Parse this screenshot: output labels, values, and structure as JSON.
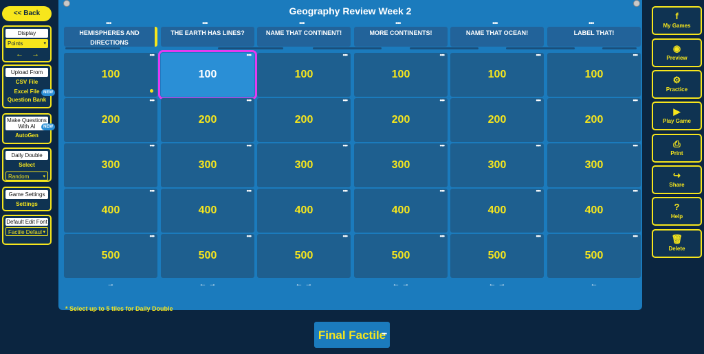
{
  "nav": {
    "back_label": "<< Back"
  },
  "left_panel": {
    "display": {
      "title": "Display",
      "selected": "Points",
      "prev_arrow": "←",
      "next_arrow": "→"
    },
    "upload": {
      "title": "Upload From",
      "csv": "CSV File",
      "excel": "Excel File",
      "bank": "Question Bank",
      "badge": "NEW"
    },
    "ai": {
      "title": "Make Questions With AI",
      "autogen": "AutoGen",
      "badge": "NEW"
    },
    "daily_double": {
      "title": "Daily Double",
      "select": "Select",
      "mode": "Random"
    },
    "game_settings": {
      "title": "Game Settings",
      "settings": "Settings"
    },
    "font": {
      "title": "Default Edit Font",
      "selected": "Factile Defaul"
    }
  },
  "board": {
    "title": "Geography Review Week 2",
    "categories": [
      {
        "label": "HEMISPHERES AND DIRECTIONS",
        "arrows": "→"
      },
      {
        "label": "THE EARTH HAS LINES?",
        "arrows": "← →"
      },
      {
        "label": "NAME THAT CONTINENT!",
        "arrows": "← →"
      },
      {
        "label": "MORE CONTINENTS!",
        "arrows": "← →"
      },
      {
        "label": "NAME THAT OCEAN!",
        "arrows": "← →"
      },
      {
        "label": "LABEL THAT!",
        "arrows": "←"
      }
    ],
    "points": [
      "100",
      "200",
      "300",
      "400",
      "500"
    ],
    "more_dots": "•••",
    "note": "* Select up to 5 tiles for Daily Double",
    "final": "Final Factile"
  },
  "right_panel": [
    {
      "label": "My Games",
      "icon": "f"
    },
    {
      "label": "Preview",
      "icon": "◉"
    },
    {
      "label": "Practice",
      "icon": "⚙"
    },
    {
      "label": "Play Game",
      "icon": "▶"
    },
    {
      "label": "Print",
      "icon": "⎙"
    },
    {
      "label": "Share",
      "icon": "↪"
    },
    {
      "label": "Help",
      "icon": "?"
    },
    {
      "label": "Delete",
      "icon": "🗑"
    }
  ],
  "colors": {
    "accent": "#f7e61c",
    "board": "#1b7bbd",
    "tile": "#1e5f8f",
    "selected_outline": "#e23bf0"
  }
}
